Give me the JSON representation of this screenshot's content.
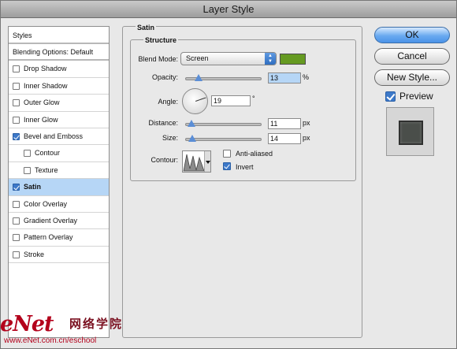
{
  "window": {
    "title": "Layer Style"
  },
  "styles_list": {
    "header": "Styles",
    "blending": "Blending Options: Default",
    "items": [
      {
        "label": "Drop Shadow",
        "checked": false,
        "indent": 0,
        "selected": false
      },
      {
        "label": "Inner Shadow",
        "checked": false,
        "indent": 0,
        "selected": false
      },
      {
        "label": "Outer Glow",
        "checked": false,
        "indent": 0,
        "selected": false
      },
      {
        "label": "Inner Glow",
        "checked": false,
        "indent": 0,
        "selected": false
      },
      {
        "label": "Bevel and Emboss",
        "checked": true,
        "indent": 0,
        "selected": false
      },
      {
        "label": "Contour",
        "checked": false,
        "indent": 1,
        "selected": false
      },
      {
        "label": "Texture",
        "checked": false,
        "indent": 1,
        "selected": false
      },
      {
        "label": "Satin",
        "checked": true,
        "indent": 0,
        "selected": true
      },
      {
        "label": "Color Overlay",
        "checked": false,
        "indent": 0,
        "selected": false
      },
      {
        "label": "Gradient Overlay",
        "checked": false,
        "indent": 0,
        "selected": false
      },
      {
        "label": "Pattern Overlay",
        "checked": false,
        "indent": 0,
        "selected": false
      },
      {
        "label": "Stroke",
        "checked": false,
        "indent": 0,
        "selected": false
      }
    ]
  },
  "satin": {
    "group_title": "Satin",
    "structure_title": "Structure",
    "blend_mode": {
      "label": "Blend Mode:",
      "value": "Screen",
      "color": "#659a21"
    },
    "opacity": {
      "label": "Opacity:",
      "value": "13",
      "unit": "%",
      "level": 0.13
    },
    "angle": {
      "label": "Angle:",
      "value": "19",
      "unit": "°"
    },
    "distance": {
      "label": "Distance:",
      "value": "11",
      "unit": "px",
      "level": 0.045
    },
    "size": {
      "label": "Size:",
      "value": "14",
      "unit": "px",
      "level": 0.056
    },
    "contour": {
      "label": "Contour:"
    },
    "anti_aliased": {
      "label": "Anti-aliased",
      "checked": false
    },
    "invert": {
      "label": "Invert",
      "checked": true
    }
  },
  "buttons": {
    "ok": "OK",
    "cancel": "Cancel",
    "new_style": "New Style..."
  },
  "preview": {
    "label": "Preview",
    "checked": true
  },
  "watermark": {
    "logo": "eNet",
    "cn": "网络学院",
    "url": "www.eNet.com.cn/eschool"
  }
}
